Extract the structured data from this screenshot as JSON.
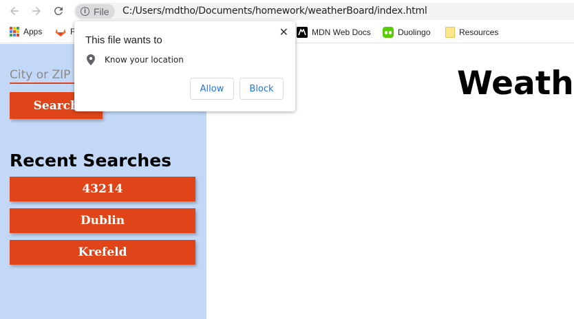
{
  "browser": {
    "chip_label": "File",
    "url": "C:/Users/mdtho/Documents/homework/weatherBoard/index.html",
    "bookmarks": [
      {
        "label": "Apps",
        "icon": "apps-icon"
      },
      {
        "label": "F",
        "icon": "gitlab-icon"
      },
      {
        "label": "MDN Web Docs",
        "icon": "mdn-icon"
      },
      {
        "label": "Duolingo",
        "icon": "duolingo-icon"
      },
      {
        "label": "Resources",
        "icon": "folder-icon"
      }
    ]
  },
  "permission_popup": {
    "title": "This file wants to",
    "permission": "Know your location",
    "allow_label": "Allow",
    "block_label": "Block",
    "close_glyph": "✕"
  },
  "sidebar": {
    "search_placeholder": "City or ZIP",
    "search_button": "Search",
    "recent_title": "Recent Searches",
    "recent": [
      "43214",
      "Dublin",
      "Krefeld"
    ]
  },
  "main": {
    "title": "Weather Dashboard"
  },
  "colors": {
    "accent": "#e0451a",
    "sidebar_bg": "#c2d8f6",
    "link_blue": "#1a73e8"
  }
}
